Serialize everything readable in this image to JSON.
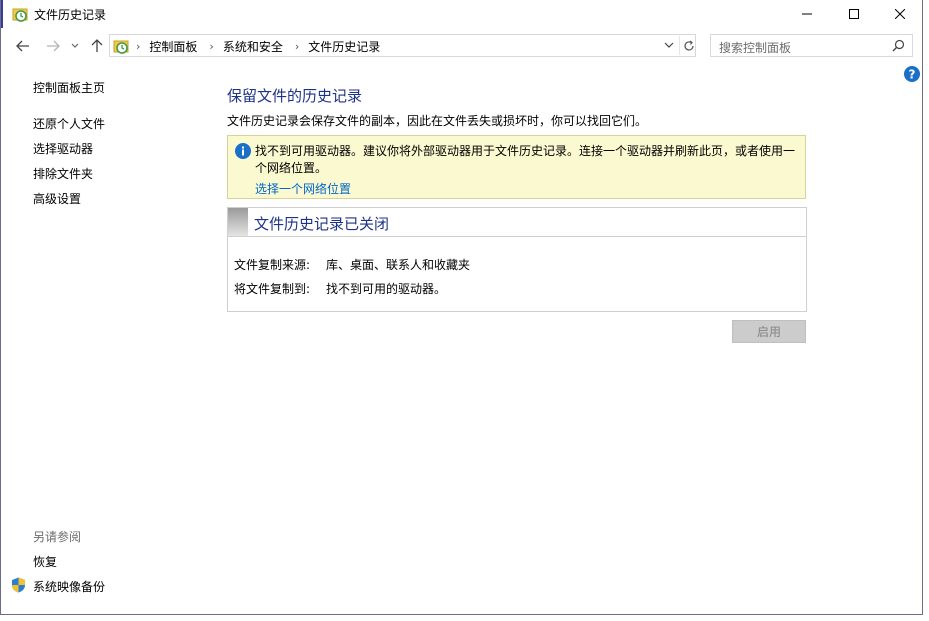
{
  "window": {
    "title": "文件历史记录"
  },
  "address": {
    "crumbs": [
      "控制面板",
      "系统和安全",
      "文件历史记录"
    ]
  },
  "search": {
    "placeholder": "搜索控制面板"
  },
  "sidebar": {
    "home": "控制面板主页",
    "items": [
      {
        "label": "还原个人文件"
      },
      {
        "label": "选择驱动器"
      },
      {
        "label": "排除文件夹"
      },
      {
        "label": "高级设置"
      }
    ],
    "see_also_heading": "另请参阅",
    "see_also": [
      {
        "label": "恢复"
      },
      {
        "label": "系统映像备份"
      }
    ]
  },
  "main": {
    "title": "保留文件的历史记录",
    "description": "文件历史记录会保存文件的副本，因此在文件丢失或损坏时，你可以找回它们。",
    "warning": {
      "text": "找不到可用驱动器。建议你将外部驱动器用于文件历史记录。连接一个驱动器并刷新此页，或者使用一个网络位置。",
      "link": "选择一个网络位置"
    },
    "status": {
      "title": "文件历史记录已关闭",
      "source_label": "文件复制来源:",
      "source_value": "库、桌面、联系人和收藏夹",
      "dest_label": "将文件复制到:",
      "dest_value": "找不到可用的驱动器。"
    },
    "enable_button": "启用"
  },
  "colors": {
    "heading": "#1e3287",
    "link": "#0066cc",
    "warning_bg": "#fbf9d0",
    "info_icon": "#1a6fc7"
  }
}
